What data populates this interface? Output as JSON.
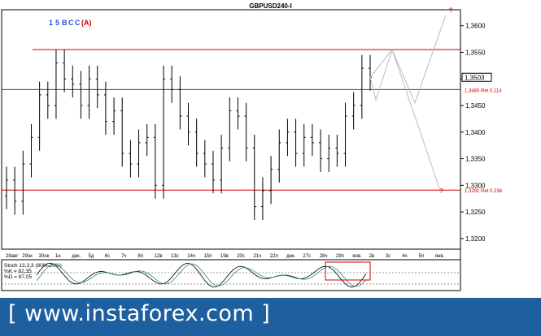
{
  "title": "GBPUSD240-I",
  "banner": "[  www.instaforex.com  ]",
  "main": {
    "price_ticks": [
      1.36,
      1.355,
      1.35,
      1.345,
      1.34,
      1.335,
      1.33,
      1.325,
      1.32
    ],
    "price_tick_labels": [
      "1,3600",
      "1,3550",
      "1,3500",
      "1,3450",
      "1,3400",
      "1,3350",
      "1,3300",
      "1,3250",
      "1,3200"
    ],
    "current_price": "1,3503",
    "date_labels": [
      "28авг",
      "29ок",
      "30ок",
      "1н",
      "дек.",
      "5д",
      "6с",
      "7ч",
      "8п",
      "12в",
      "13с",
      "14ч",
      "15п",
      "19в",
      "20с",
      "21ч",
      "22п",
      "дек.",
      "27с",
      "28ч",
      "29п",
      "янв.",
      "2в",
      "3с",
      "4ч",
      "5п",
      "янв."
    ],
    "levels": [
      {
        "label": "1,3480 Ret 0.114",
        "value": 1.348,
        "color": "#cc0000"
      },
      {
        "label": "1,3291 Ret 0.236",
        "value": 1.3291,
        "color": "#cc0000"
      }
    ],
    "top_level": 1.3555,
    "colors": {
      "level": "#cc0000",
      "wave_blue": "#2a4dd8",
      "wave_red": "#cc0000",
      "forecast": "#bbbbbb",
      "candle": "#000000"
    }
  },
  "wave_labels": [
    {
      "text": "1",
      "color": "#2a4dd8"
    },
    {
      "text": "5",
      "color": "#2a4dd8"
    },
    {
      "text": "B",
      "color": "#2a4dd8"
    },
    {
      "text": "C",
      "color": "#2a4dd8"
    },
    {
      "text": "C",
      "color": "#2a4dd8"
    },
    {
      "text": "(A)",
      "color": "#cc0000"
    }
  ],
  "stoch": {
    "title": "Stoch 13,3,3 (80%-20%)",
    "k_label": "%K = 82,35",
    "d_label": "%D = 87,05",
    "k": 82.35,
    "d": 87.05
  },
  "chart_data": {
    "type": "candlestick",
    "title": "GBPUSD240-I",
    "ylim": [
      1.318,
      1.363
    ],
    "levels": [
      1.348,
      1.3291
    ],
    "candles_close": [
      1.331,
      1.327,
      1.334,
      1.339,
      1.347,
      1.345,
      1.353,
      1.35,
      1.349,
      1.345,
      1.35,
      1.347,
      1.342,
      1.344,
      1.336,
      1.334,
      1.338,
      1.339,
      1.33,
      1.35,
      1.348,
      1.343,
      1.34,
      1.336,
      1.334,
      1.331,
      1.337,
      1.344,
      1.343,
      1.337,
      1.326,
      1.329,
      1.333,
      1.338,
      1.34,
      1.336,
      1.339,
      1.338,
      1.335,
      1.337,
      1.336,
      1.343,
      1.345,
      1.352,
      1.3503
    ],
    "forecast": [
      {
        "path": "blue-scenario",
        "points": [
          1.3503,
          1.3555,
          1.346,
          1.361,
          1.3291
        ]
      }
    ]
  }
}
